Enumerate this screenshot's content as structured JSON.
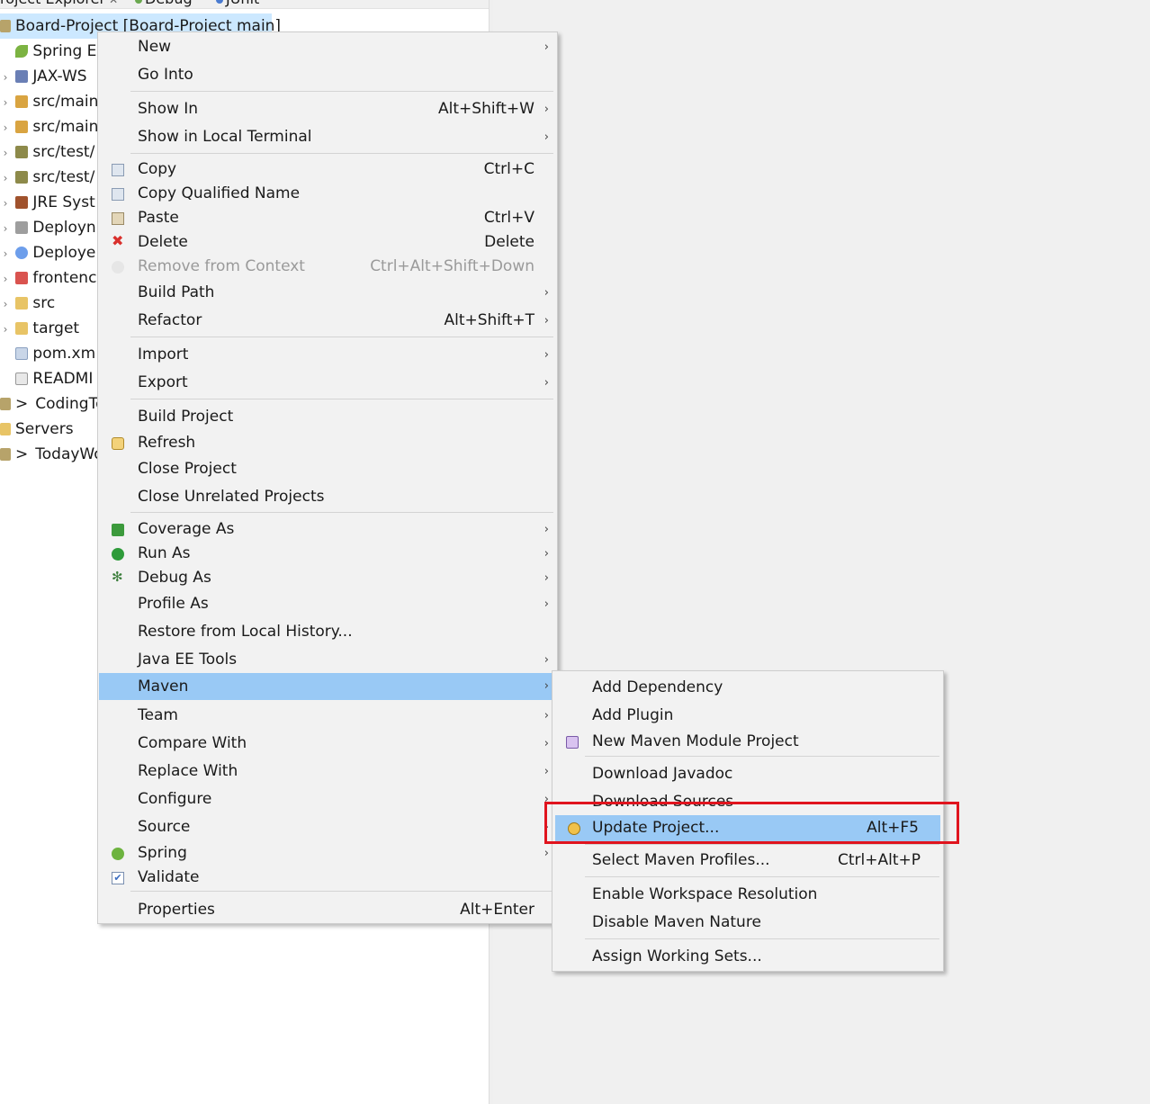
{
  "tabs": {
    "explorer": "roject Explorer",
    "explorer_close": "✕",
    "debug": "Debug",
    "junit": "JUnit"
  },
  "tree": {
    "project": "Board-Project [Board-Project main]",
    "items": [
      {
        "label": "Spring E",
        "icon": "spring-leaf-icon"
      },
      {
        "label": "JAX-WS",
        "icon": "webservice-icon"
      },
      {
        "label": "src/main",
        "icon": "package-folder-icon"
      },
      {
        "label": "src/main",
        "icon": "package-folder-icon"
      },
      {
        "label": "src/test/",
        "icon": "package-folder-icon"
      },
      {
        "label": "src/test/",
        "icon": "package-folder-icon"
      },
      {
        "label": "JRE Syst",
        "icon": "library-icon"
      },
      {
        "label": "Deployn",
        "icon": "deployment-icon"
      },
      {
        "label": "Deploye",
        "icon": "deployed-resources-icon"
      },
      {
        "label": "frontenc",
        "icon": "folder-icon"
      },
      {
        "label": "src",
        "icon": "folder-icon"
      },
      {
        "label": "target",
        "icon": "folder-open-icon"
      },
      {
        "label": "pom.xm",
        "icon": "xml-file-icon"
      },
      {
        "label": "READMI",
        "icon": "text-file-icon"
      }
    ],
    "codingte": "CodingTe",
    "servers": "Servers",
    "todaywo": "TodayWo",
    "chevron": ">"
  },
  "context_menu": {
    "items": [
      {
        "label": "New",
        "shortcut": "",
        "submenu": true
      },
      {
        "label": "Go Into",
        "shortcut": "",
        "submenu": false
      },
      {
        "label": "Show In",
        "shortcut": "Alt+Shift+W",
        "submenu": true
      },
      {
        "label": "Show in Local Terminal",
        "shortcut": "",
        "submenu": true
      },
      {
        "label": "Copy",
        "shortcut": "Ctrl+C",
        "submenu": false
      },
      {
        "label": "Copy Qualified Name",
        "shortcut": "",
        "submenu": false
      },
      {
        "label": "Paste",
        "shortcut": "Ctrl+V",
        "submenu": false
      },
      {
        "label": "Delete",
        "shortcut": "Delete",
        "submenu": false
      },
      {
        "label": "Remove from Context",
        "shortcut": "Ctrl+Alt+Shift+Down",
        "submenu": false
      },
      {
        "label": "Build Path",
        "shortcut": "",
        "submenu": true
      },
      {
        "label": "Refactor",
        "shortcut": "Alt+Shift+T",
        "submenu": true
      },
      {
        "label": "Import",
        "shortcut": "",
        "submenu": true
      },
      {
        "label": "Export",
        "shortcut": "",
        "submenu": true
      },
      {
        "label": "Build Project",
        "shortcut": "",
        "submenu": false
      },
      {
        "label": "Refresh",
        "shortcut": "",
        "submenu": false
      },
      {
        "label": "Close Project",
        "shortcut": "",
        "submenu": false
      },
      {
        "label": "Close Unrelated Projects",
        "shortcut": "",
        "submenu": false
      },
      {
        "label": "Coverage As",
        "shortcut": "",
        "submenu": true
      },
      {
        "label": "Run As",
        "shortcut": "",
        "submenu": true
      },
      {
        "label": "Debug As",
        "shortcut": "",
        "submenu": true
      },
      {
        "label": "Profile As",
        "shortcut": "",
        "submenu": true
      },
      {
        "label": "Restore from Local History...",
        "shortcut": "",
        "submenu": false
      },
      {
        "label": "Java EE Tools",
        "shortcut": "",
        "submenu": true
      },
      {
        "label": "Maven",
        "shortcut": "",
        "submenu": true
      },
      {
        "label": "Team",
        "shortcut": "",
        "submenu": true
      },
      {
        "label": "Compare With",
        "shortcut": "",
        "submenu": true
      },
      {
        "label": "Replace With",
        "shortcut": "",
        "submenu": true
      },
      {
        "label": "Configure",
        "shortcut": "",
        "submenu": true
      },
      {
        "label": "Source",
        "shortcut": "",
        "submenu": true
      },
      {
        "label": "Spring",
        "shortcut": "",
        "submenu": true
      },
      {
        "label": "Validate",
        "shortcut": "",
        "submenu": false
      },
      {
        "label": "Properties",
        "shortcut": "Alt+Enter",
        "submenu": false
      }
    ],
    "arrow": "›"
  },
  "maven_submenu": {
    "items": [
      {
        "label": "Add Dependency",
        "shortcut": ""
      },
      {
        "label": "Add Plugin",
        "shortcut": ""
      },
      {
        "label": "New Maven Module Project",
        "shortcut": ""
      },
      {
        "label": "Download Javadoc",
        "shortcut": ""
      },
      {
        "label": "Download Sources",
        "shortcut": ""
      },
      {
        "label": "Update Project...",
        "shortcut": "Alt+F5"
      },
      {
        "label": "Select Maven Profiles...",
        "shortcut": "Ctrl+Alt+P"
      },
      {
        "label": "Enable Workspace Resolution",
        "shortcut": ""
      },
      {
        "label": "Disable Maven Nature",
        "shortcut": ""
      },
      {
        "label": "Assign Working Sets...",
        "shortcut": ""
      }
    ]
  },
  "colors": {
    "highlight": "#99c9f5",
    "menu_bg": "#f2f2f2",
    "callout": "#e0141e",
    "tree_selection": "#cce8ff"
  }
}
